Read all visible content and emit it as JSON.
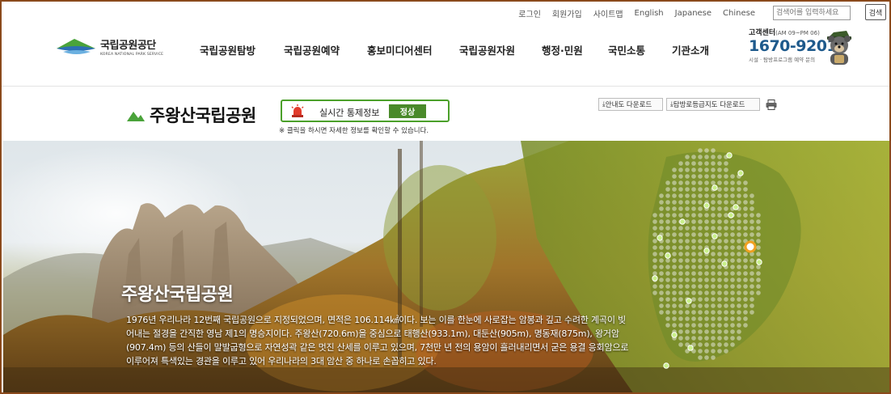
{
  "utility": {
    "links": [
      "로그인",
      "회원가입",
      "사이트맵",
      "English",
      "Japanese",
      "Chinese"
    ],
    "search_placeholder": "검색어를 입력하세요",
    "search_button": "검색"
  },
  "logo": {
    "ko": "국립공원공단",
    "en": "KOREA NATIONAL PARK SERVICE"
  },
  "gnb": [
    "국립공원탐방",
    "국립공원예약",
    "홍보미디어센터",
    "국립공원자원",
    "행정·민원",
    "국민소통",
    "기관소개"
  ],
  "customer_center": {
    "label": "고객센터",
    "hours": "(AM 09~PM 06)",
    "phone": "1670-9201",
    "sub": "시설 · 탐방프로그램 예약 문의"
  },
  "park": {
    "name": "주왕산국립공원",
    "status_label": "실시간 통제정보",
    "status_value": "정상",
    "note": "※ 클릭을 하시면 자세한 정보를 확인할 수 있습니다.",
    "download_guide": "안내도 다운로드",
    "download_trail": "탐방로등급지도 다운로드"
  },
  "hero": {
    "title": "주왕산국립공원",
    "description": "1976년 우리나라 12번째 국립공원으로 지정되었으며, 면적은 106.114㎢이다. 보는 이를 한눈에 사로잡는 암봉과 깊고 수려한 계곡이 빚어내는 절경을 간직한 영남 제1의 명승지이다. 주왕산(720.6m)을 중심으로 태행산(933.1m), 대둔산(905m), 명동재(875m), 왕거암(907.4m) 등의 산들이 말발굽형으로 자연성곽 같은 멋진 산세를 이루고 있으며, 7천만 년 전의 용암이 흘러내리면서 굳은 용결 응회암으로 이루어져 특색있는 경관을 이루고 있어 우리나라의 3대 암산 중 하나로 손꼽히고 있다."
  },
  "colors": {
    "status_green": "#4a8a2a",
    "phone_blue": "#1e5a8c",
    "frame": "#8b4a1c"
  }
}
